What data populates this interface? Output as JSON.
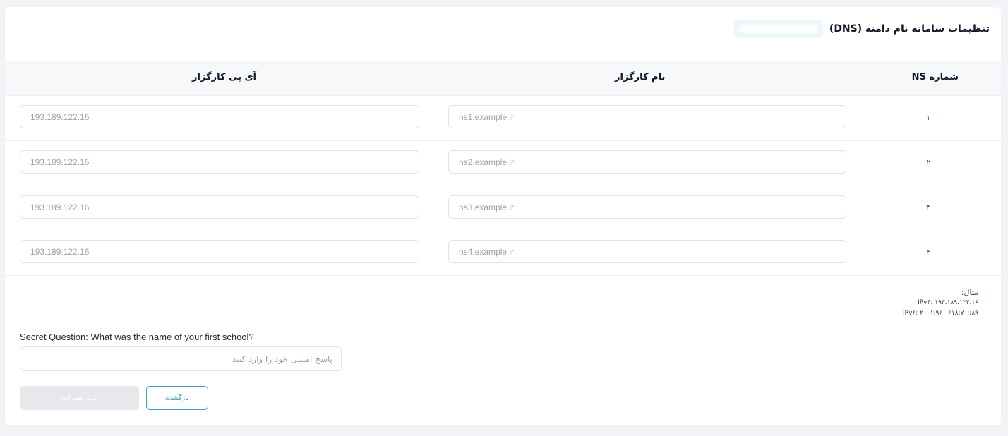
{
  "header": {
    "title": "تنظیمات سامانه نام دامنه (DNS)"
  },
  "table": {
    "columns": {
      "ns": "شماره NS",
      "name": "نام کارگزار",
      "ip": "آی پی کارگزار"
    },
    "rows": [
      {
        "num": "۱",
        "name_placeholder": "ns1.example.ir",
        "ip_placeholder": "193.189.122.16"
      },
      {
        "num": "۲",
        "name_placeholder": "ns2.example.ir",
        "ip_placeholder": "193.189.122.16"
      },
      {
        "num": "۳",
        "name_placeholder": "ns3.example.ir",
        "ip_placeholder": "193.189.122.16"
      },
      {
        "num": "۴",
        "name_placeholder": "ns4.example.ir",
        "ip_placeholder": "193.189.122.16"
      }
    ]
  },
  "example": {
    "label": "مثال:",
    "ipv4": "IPv۴: ۱۹۳.۱۸۹.۱۲۲.۱۶",
    "ipv6": "IPv۶: ۲۰۰۱:۹۶۰:۶۱۸:۷۰::۸۹"
  },
  "security": {
    "question": "Secret Question: What was the name of your first school?",
    "answer_placeholder": "پاسخ امنیتی خود را وارد کنید"
  },
  "buttons": {
    "back": "بازگشت",
    "submit": "ثبت تغییرات"
  },
  "colors": {
    "accent": "#3aa7c2",
    "disabled": "#e6e8eb"
  }
}
